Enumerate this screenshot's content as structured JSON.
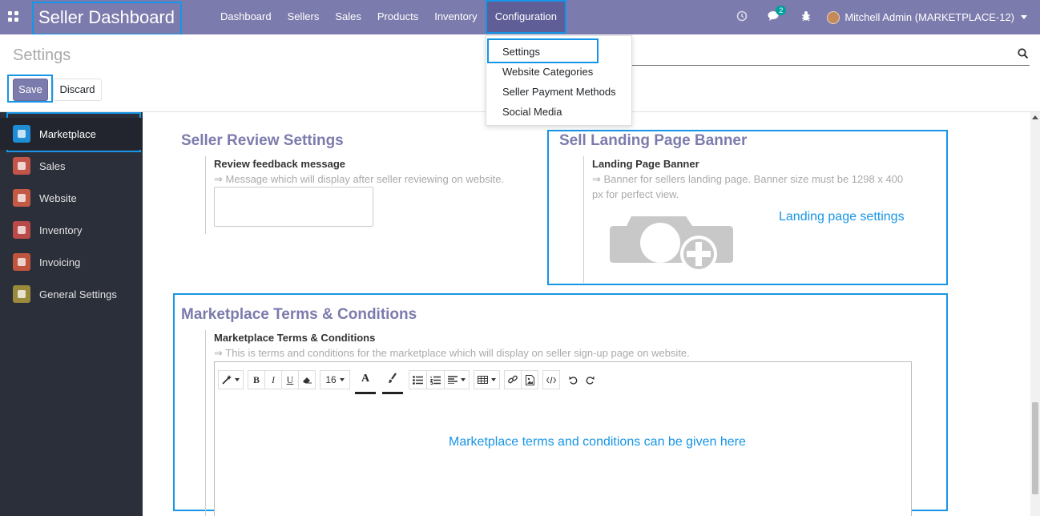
{
  "app": {
    "title": "Seller Dashboard"
  },
  "menu": {
    "items": [
      "Dashboard",
      "Sellers",
      "Sales",
      "Products",
      "Inventory",
      "Configuration"
    ],
    "active": "Configuration"
  },
  "systray": {
    "messages_count": "2",
    "user_label": "Mitchell Admin (MARKETPLACE-12)"
  },
  "dropdown": {
    "items": [
      "Settings",
      "Website Categories",
      "Seller Payment Methods",
      "Social Media"
    ]
  },
  "control_panel": {
    "title": "Settings",
    "save_label": "Save",
    "discard_label": "Discard"
  },
  "sidebar": {
    "items": [
      {
        "label": "Marketplace",
        "icon": "marketplace-icon",
        "color": "#1f8dd6"
      },
      {
        "label": "Sales",
        "icon": "sales-icon",
        "color": "#c2544a"
      },
      {
        "label": "Website",
        "icon": "website-icon",
        "color": "#c25a45"
      },
      {
        "label": "Inventory",
        "icon": "inventory-icon",
        "color": "#b94a48"
      },
      {
        "label": "Invoicing",
        "icon": "invoicing-icon",
        "color": "#c0553f"
      },
      {
        "label": "General Settings",
        "icon": "gear-icon",
        "color": "#9a8a3c"
      }
    ]
  },
  "sections": {
    "review": {
      "title": "Seller Review Settings",
      "field_label": "Review feedback message",
      "help": "⇒ Message which will display after seller reviewing on website.",
      "value": ""
    },
    "banner": {
      "title": "Sell Landing Page Banner",
      "field_label": "Landing Page Banner",
      "help": "⇒ Banner for sellers landing page. Banner size must be 1298 x 400 px for perfect view.",
      "annotation": "Landing page settings"
    },
    "terms": {
      "title": "Marketplace Terms & Conditions",
      "field_label": "Marketplace Terms & Conditions",
      "help": "⇒ This is terms and conditions for the marketplace which will display on seller sign-up page on website.",
      "annotation": "Marketplace terms and conditions can be given here",
      "font_size": "16"
    }
  },
  "colors": {
    "brand": "#7c7bad",
    "annotation": "#1795e6",
    "sidebar": "#2b2f39"
  }
}
